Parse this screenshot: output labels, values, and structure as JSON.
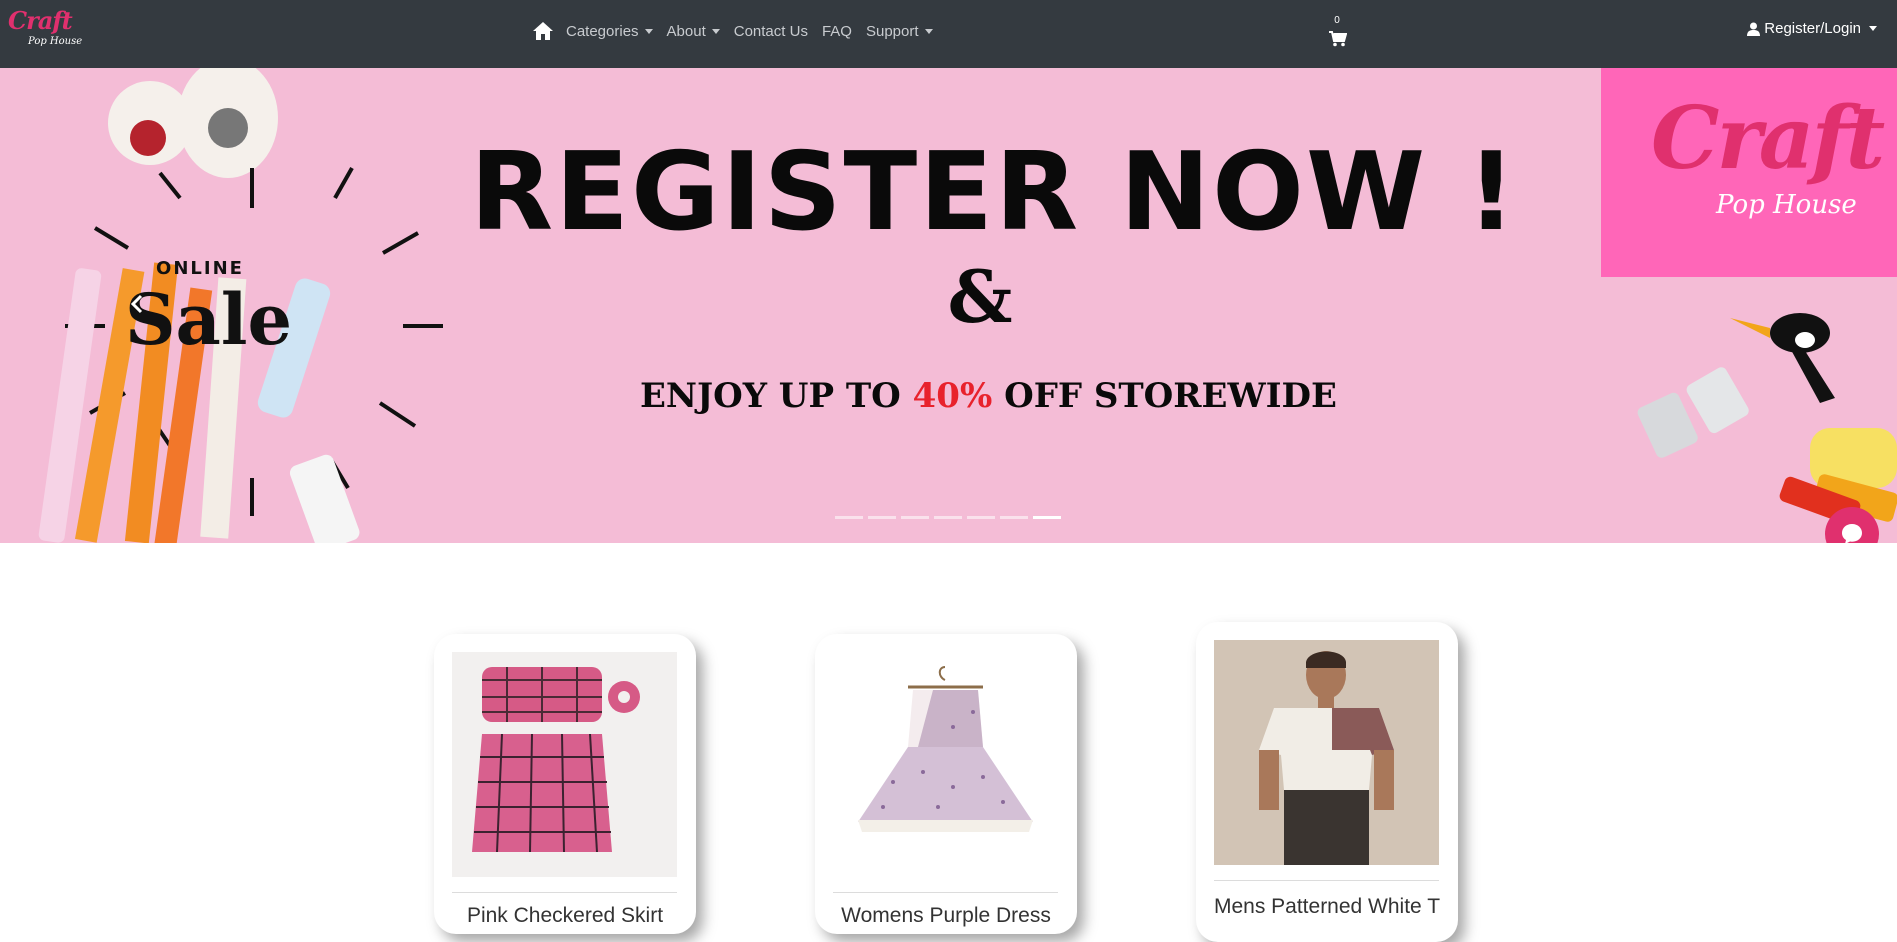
{
  "brand": {
    "logo_main": "Craft",
    "logo_sub": "Pop House"
  },
  "nav": {
    "items": [
      {
        "label": "Categories",
        "dropdown": true
      },
      {
        "label": "About",
        "dropdown": true
      },
      {
        "label": "Contact Us",
        "dropdown": false
      },
      {
        "label": "FAQ",
        "dropdown": false
      },
      {
        "label": "Support",
        "dropdown": true
      }
    ],
    "cart_count": "0",
    "register_label": "Register/Login"
  },
  "banner": {
    "headline": "REGISTER NOW !",
    "ampersand": "&",
    "sub_prefix": "ENJOY UP TO ",
    "sub_percent": "40%",
    "sub_suffix": " OFF STOREWIDE",
    "online": "ONLINE",
    "sale": "Sale",
    "brand_main": "Craft",
    "brand_sub": "Pop House",
    "slide_count": 7,
    "active_slide": 7
  },
  "products": [
    {
      "title": "Pink Checkered Skirt"
    },
    {
      "title": "Womens Purple Dress"
    },
    {
      "title": "Mens Patterned White T"
    }
  ],
  "colors": {
    "navbar": "#343a40",
    "accent": "#e0306e",
    "banner_bg": "#f4bcd6"
  }
}
